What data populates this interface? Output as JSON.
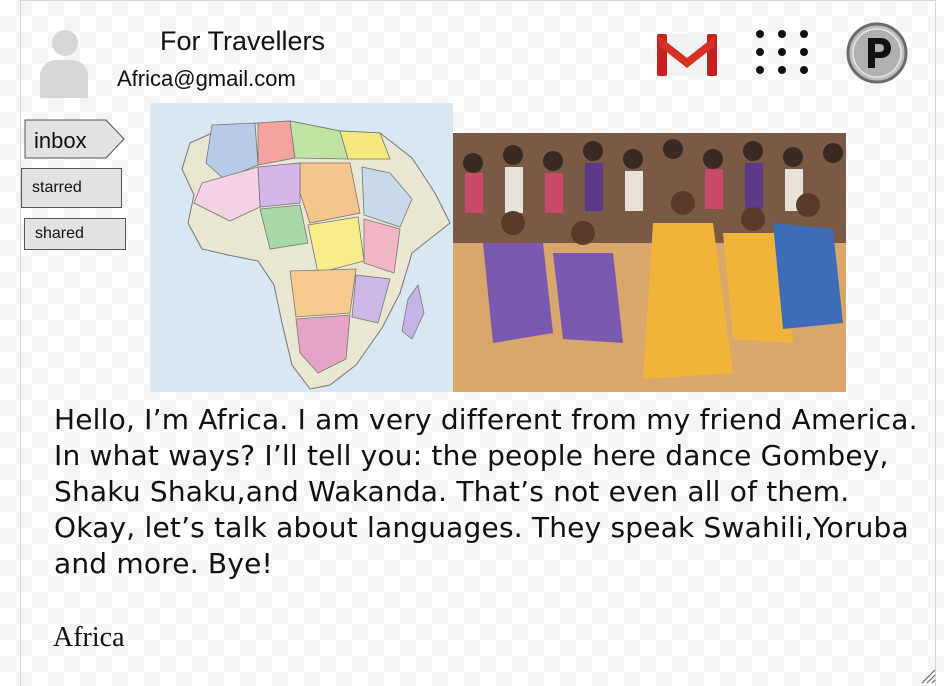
{
  "header": {
    "title": "For Travellers",
    "email": "Africa@gmail.com"
  },
  "icons": {
    "avatar": "user-avatar-icon",
    "mail": "gmail-logo",
    "apps": "apps-grid-icon",
    "profile": "profile-p-icon"
  },
  "nav": {
    "inbox": "inbox",
    "starred": "starred",
    "shared": "shared"
  },
  "message": {
    "body": "Hello, I’m Africa. I am very different from my friend America. In what ways? I’ll tell you: the people here dance Gombey, Shaku Shaku,and Wakanda. That’s not even all of them. Okay, let’s talk about languages. They speak Swahili,Yoruba and more. Bye!",
    "signature": "Africa"
  },
  "colors": {
    "gmail_red": "#d93025",
    "nav_bg": "#e2e2e2",
    "map_water": "#d8e7f2"
  }
}
